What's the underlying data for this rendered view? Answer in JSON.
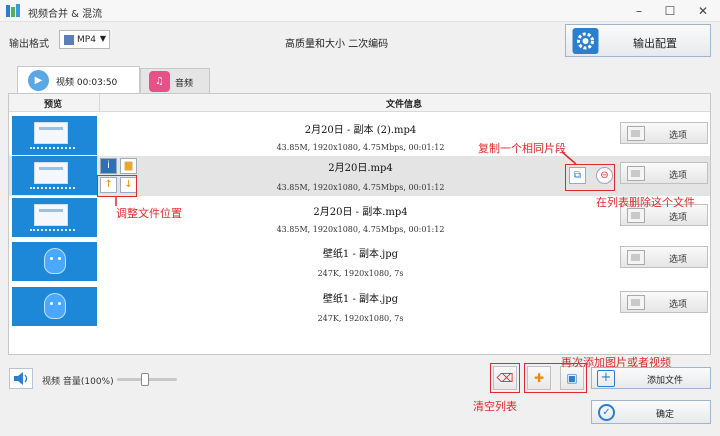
{
  "window": {
    "title": "视频合并 & 混流",
    "minimize": "–",
    "maximize": "☐",
    "close": "✕"
  },
  "output": {
    "label": "输出格式",
    "format": "MP4",
    "quality": "高质量和大小 二次编码",
    "config_button": "输出配置"
  },
  "tabs": [
    {
      "label": "视频 00:03:50",
      "icon": "play-icon",
      "active": true
    },
    {
      "label": "音频",
      "icon": "music-icon",
      "active": false
    }
  ],
  "table": {
    "headers": [
      "预览",
      "文件信息"
    ],
    "rows": [
      {
        "name": "2月20日 - 副本 (2).mp4",
        "info": "43.85M, 1920x1080, 4.75Mbps, 00:01:12",
        "option": "选项",
        "thumb": "desktop"
      },
      {
        "name": "2月20日.mp4",
        "info": "43.85M, 1920x1080, 4.75Mbps, 00:01:12",
        "option": "选项",
        "thumb": "desktop",
        "selected": true
      },
      {
        "name": "2月20日 - 副本.mp4",
        "info": "43.85M, 1920x1080, 4.75Mbps, 00:01:12",
        "option": "选项",
        "thumb": "desktop"
      },
      {
        "name": "壁纸1 - 副本.jpg",
        "info": "247K, 1920x1080, 7s",
        "option": "选项",
        "thumb": "mascot"
      },
      {
        "name": "壁纸1 - 副本.jpg",
        "info": "247K, 1920x1080, 7s",
        "option": "选项",
        "thumb": "mascot"
      }
    ]
  },
  "annotations": {
    "move": "调整文件位置",
    "duplicate": "复制一个相同片段",
    "remove": "在列表删除这个文件",
    "clear": "清空列表",
    "add_more": "再次添加图片或者视频"
  },
  "bottom": {
    "volume_label": "视频 音量(100%)",
    "volume": 1.0,
    "add_button": "添加文件",
    "ok_button": "确定"
  },
  "colors": {
    "accent": "#2b7fcf",
    "annotation": "#e02a2a",
    "thumb_bg": "#1e88d8"
  }
}
